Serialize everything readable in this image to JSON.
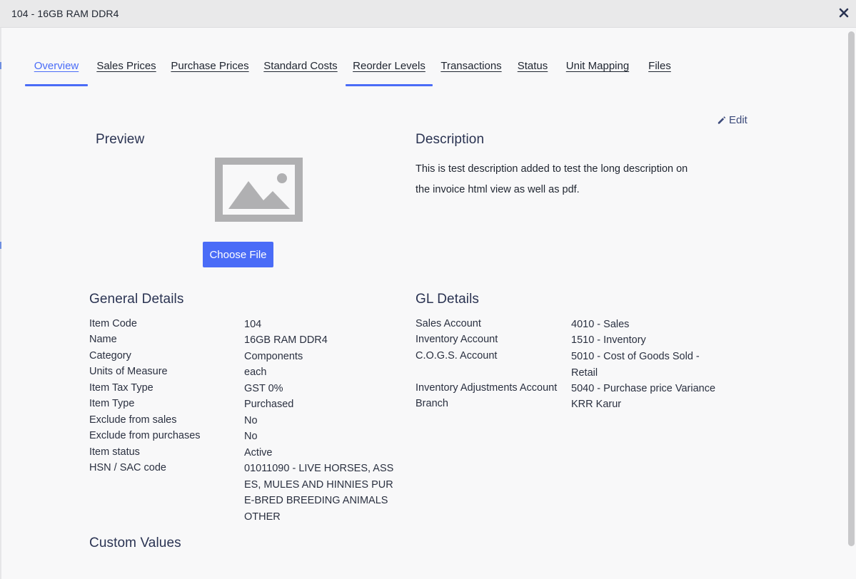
{
  "dialog": {
    "title": "104 - 16GB RAM DDR4"
  },
  "tabs": [
    {
      "label": "Overview"
    },
    {
      "label": "Sales Prices"
    },
    {
      "label": "Purchase Prices"
    },
    {
      "label": "Standard Costs"
    },
    {
      "label": "Reorder Levels"
    },
    {
      "label": "Transactions"
    },
    {
      "label": "Status"
    },
    {
      "label": "Unit Mapping"
    },
    {
      "label": "Files"
    }
  ],
  "edit_label": "Edit",
  "preview": {
    "title": "Preview",
    "choose_file_label": "Choose File"
  },
  "description": {
    "title": "Description",
    "text": "This is test description added to test the long description on the invoice html view as well as pdf."
  },
  "general_details": {
    "title": "General Details",
    "rows": [
      {
        "label": "Item Code",
        "value": "104"
      },
      {
        "label": "Name",
        "value": "16GB RAM DDR4"
      },
      {
        "label": "Category",
        "value": "Components"
      },
      {
        "label": "Units of Measure",
        "value": "each"
      },
      {
        "label": "Item Tax Type",
        "value": "GST 0%"
      },
      {
        "label": "Item Type",
        "value": "Purchased"
      },
      {
        "label": "Exclude from sales",
        "value": "No"
      },
      {
        "label": "Exclude from purchases",
        "value": "No"
      },
      {
        "label": "Item status",
        "value": "Active"
      },
      {
        "label": "HSN / SAC code",
        "value": "01011090 - LIVE HORSES, ASSES, MULES AND HINNIES PURE-BRED BREEDING ANIMALS OTHER"
      }
    ]
  },
  "gl_details": {
    "title": "GL Details",
    "rows": [
      {
        "label": "Sales Account",
        "value": "4010 - Sales"
      },
      {
        "label": "Inventory Account",
        "value": "1510 - Inventory"
      },
      {
        "label": "C.O.G.S. Account",
        "value": "5010 - Cost of Goods Sold - Retail"
      },
      {
        "label": "Inventory Adjustments Account",
        "value": "5040 - Purchase price Variance"
      },
      {
        "label": "Branch",
        "value": "KRR Karur"
      }
    ]
  },
  "custom_values": {
    "title": "Custom Values"
  },
  "colors": {
    "accent": "#4a6cf7",
    "heading": "#2a3352",
    "titlebar": "#e9e9ea",
    "background": "#f8f8f9"
  }
}
